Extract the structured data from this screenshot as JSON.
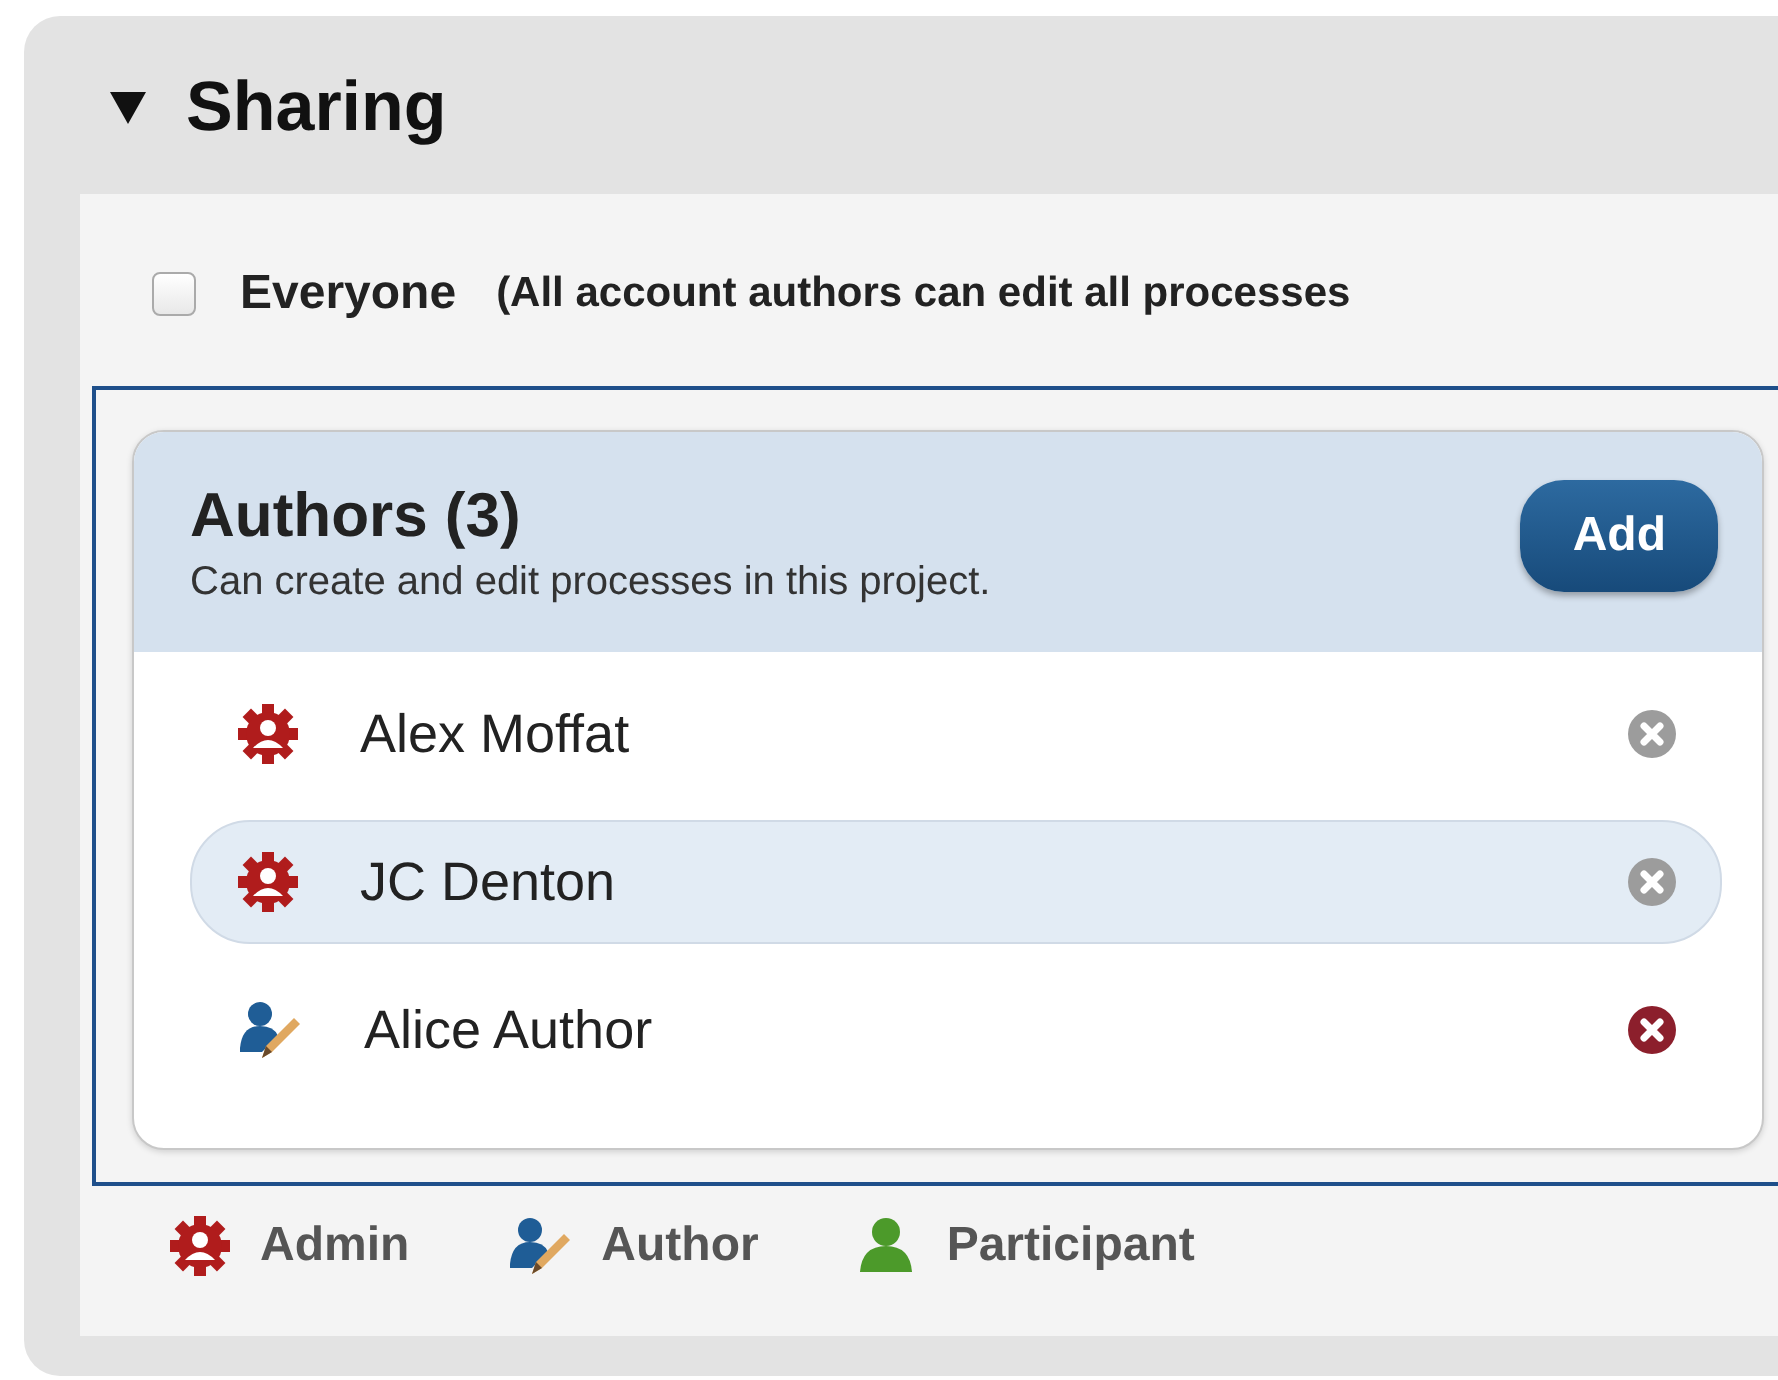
{
  "section": {
    "title": "Sharing",
    "expanded": true
  },
  "everyone": {
    "label": "Everyone",
    "note": "(All account authors can edit all processes",
    "checked": false
  },
  "authors": {
    "title": "Authors (3)",
    "subtitle": "Can create and edit processes in this project.",
    "add_button": "Add",
    "members": [
      {
        "name": "Alex Moffat",
        "kind": "admin",
        "selected": false,
        "remove_active": false
      },
      {
        "name": "JC Denton",
        "kind": "admin",
        "selected": true,
        "remove_active": false
      },
      {
        "name": "Alice Author",
        "kind": "author",
        "selected": false,
        "remove_active": true
      }
    ]
  },
  "legend": [
    {
      "label": "Admin",
      "kind": "admin"
    },
    {
      "label": "Author",
      "kind": "author"
    },
    {
      "label": "Participant",
      "kind": "participant"
    }
  ]
}
